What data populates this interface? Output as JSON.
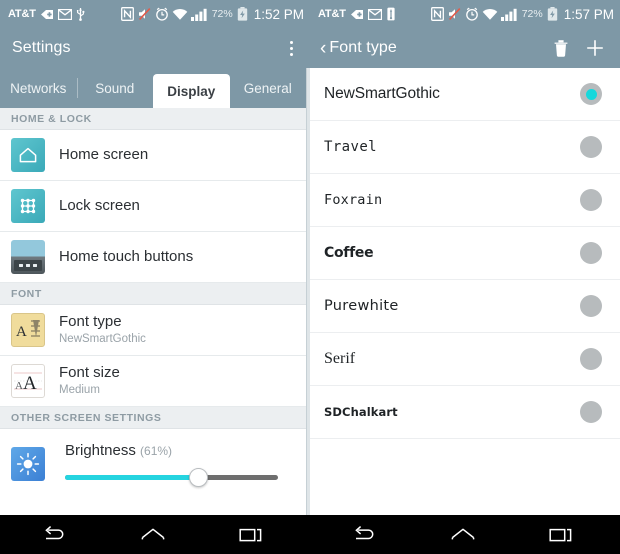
{
  "status_bars": [
    {
      "carrier": "AT&T",
      "icons": [
        "sd-card-icon",
        "email-icon",
        "usb-icon",
        "nfc-icon",
        "mute-icon",
        "alarm-icon",
        "wifi-icon",
        "signal-icon"
      ],
      "battery_percent": "72%",
      "battery_icon": "battery-charging-icon",
      "time": "1:52 PM"
    },
    {
      "carrier": "AT&T",
      "icons": [
        "sd-card-icon",
        "email-icon",
        "usb-icon",
        "nfc-icon",
        "mute-icon",
        "alarm-icon",
        "wifi-icon",
        "signal-icon"
      ],
      "battery_percent": "72%",
      "battery_icon": "battery-charging-icon",
      "time": "1:57 PM"
    }
  ],
  "left_pane": {
    "appbar": {
      "title": "Settings",
      "overflow_label": "More options"
    },
    "tabs": [
      {
        "label": "Networks",
        "active": false
      },
      {
        "label": "Sound",
        "active": false
      },
      {
        "label": "Display",
        "active": true
      },
      {
        "label": "General",
        "active": false
      }
    ],
    "sections": [
      {
        "header": "HOME & LOCK",
        "rows": [
          {
            "title": "Home screen",
            "subtitle": "",
            "icon": "home-screen-icon"
          },
          {
            "title": "Lock screen",
            "subtitle": "",
            "icon": "lock-screen-icon"
          },
          {
            "title": "Home touch buttons",
            "subtitle": "",
            "icon": "home-touch-buttons-icon"
          }
        ]
      },
      {
        "header": "FONT",
        "rows": [
          {
            "title": "Font type",
            "subtitle": "NewSmartGothic",
            "icon": "font-type-icon"
          },
          {
            "title": "Font size",
            "subtitle": "Medium",
            "icon": "font-size-icon"
          }
        ]
      },
      {
        "header": "OTHER SCREEN SETTINGS",
        "rows": []
      }
    ],
    "brightness": {
      "label": "Brightness",
      "percent_label": "(61%)",
      "value": 61,
      "icon": "brightness-icon",
      "fill_color": "#25d4e0",
      "track_color": "#6e6e6e"
    }
  },
  "right_pane": {
    "appbar": {
      "back_label": "Font type",
      "back_icon": "back-chevron-icon",
      "actions": [
        {
          "name": "delete-button",
          "icon": "trash-icon"
        },
        {
          "name": "add-button",
          "icon": "plus-icon"
        }
      ]
    },
    "fonts": [
      {
        "name": "NewSmartGothic",
        "selected": true,
        "style_class": "fn-newsmartgothic"
      },
      {
        "name": "Travel",
        "selected": false,
        "style_class": "fn-travel"
      },
      {
        "name": "Foxrain",
        "selected": false,
        "style_class": "fn-foxrain"
      },
      {
        "name": "Coffee",
        "selected": false,
        "style_class": "fn-coffee"
      },
      {
        "name": "Purewhite",
        "selected": false,
        "style_class": "fn-purewhite"
      },
      {
        "name": "Serif",
        "selected": false,
        "style_class": "fn-serif"
      },
      {
        "name": "SDChalkart",
        "selected": false,
        "style_class": "fn-sdchalkart"
      }
    ],
    "selected_font": "NewSmartGothic"
  },
  "navbars": [
    {
      "back": "back-nav-icon",
      "home": "home-nav-icon",
      "recents": "recents-nav-icon"
    },
    {
      "back": "back-nav-icon",
      "home": "home-nav-icon",
      "recents": "recents-nav-icon"
    }
  ],
  "colors": {
    "appbar": "#7e98a6",
    "accent": "#16d8dc",
    "section_header_bg": "#eceff1",
    "navbar": "#000000"
  }
}
